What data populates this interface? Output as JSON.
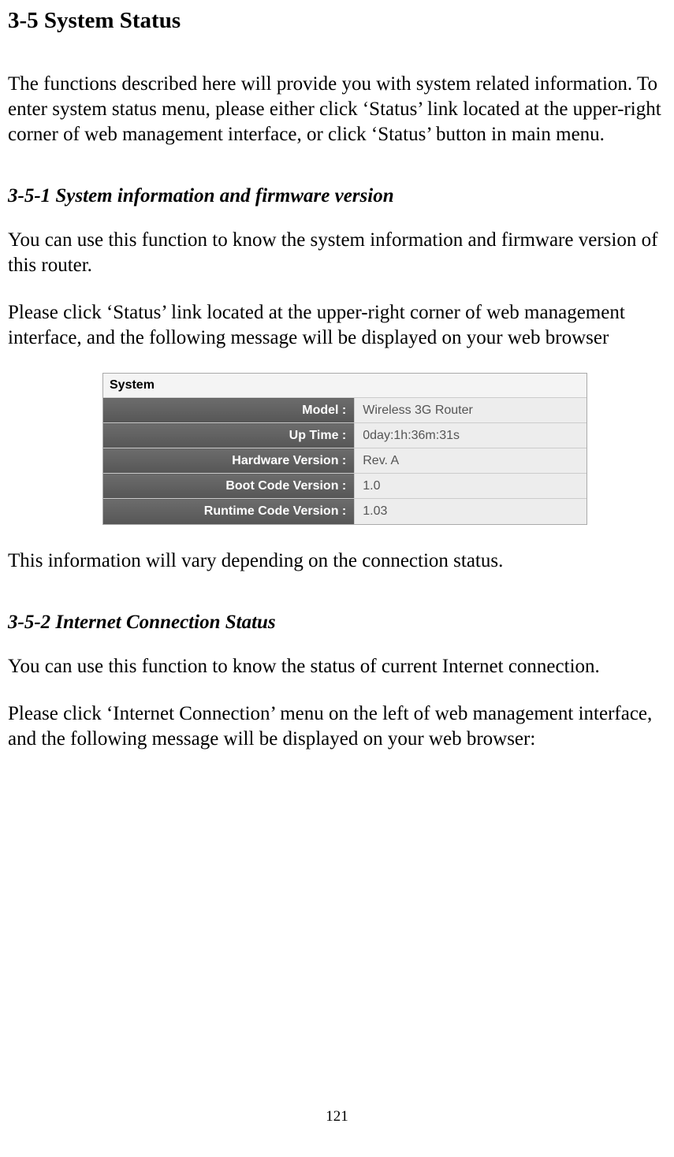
{
  "headings": {
    "main": "3-5 System Status",
    "sub1": "3-5-1 System information and firmware version",
    "sub2": "3-5-2 Internet Connection Status"
  },
  "paragraphs": {
    "intro": "The functions described here will provide you with system related information. To enter system status menu, please either click ‘Status’ link located at the upper-right corner of web management interface, or click ‘Status’ button in main menu.",
    "p1": "You can use this function to know the system information and firmware version of this router.",
    "p2": "Please click ‘Status’ link located at the upper-right corner of web management interface, and the following message will be displayed on your web browser",
    "p3": "This information will vary depending on the connection status.",
    "p4": "You can use this function to know the status of current Internet connection.",
    "p5": "Please click ‘Internet Connection’ menu on the left of web management interface, and the following message will be displayed on your web browser:"
  },
  "panel": {
    "title": "System",
    "rows": [
      {
        "label": "Model :",
        "value": "Wireless 3G Router"
      },
      {
        "label": "Up Time :",
        "value": "0day:1h:36m:31s"
      },
      {
        "label": "Hardware Version :",
        "value": "Rev. A"
      },
      {
        "label": "Boot Code Version :",
        "value": "1.0"
      },
      {
        "label": "Runtime Code Version :",
        "value": "1.03"
      }
    ]
  },
  "page_number": "121"
}
